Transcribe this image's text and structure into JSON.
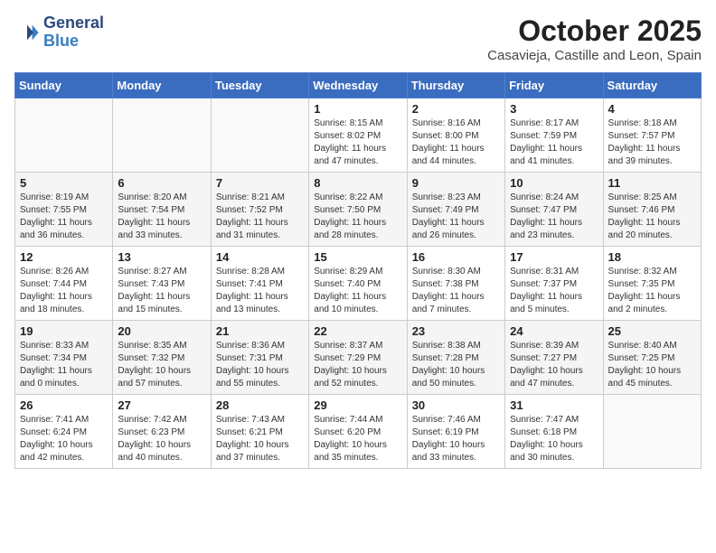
{
  "header": {
    "logo_line1": "General",
    "logo_line2": "Blue",
    "month_title": "October 2025",
    "location": "Casavieja, Castille and Leon, Spain"
  },
  "weekdays": [
    "Sunday",
    "Monday",
    "Tuesday",
    "Wednesday",
    "Thursday",
    "Friday",
    "Saturday"
  ],
  "weeks": [
    [
      {
        "day": "",
        "info": ""
      },
      {
        "day": "",
        "info": ""
      },
      {
        "day": "",
        "info": ""
      },
      {
        "day": "1",
        "info": "Sunrise: 8:15 AM\nSunset: 8:02 PM\nDaylight: 11 hours and 47 minutes."
      },
      {
        "day": "2",
        "info": "Sunrise: 8:16 AM\nSunset: 8:00 PM\nDaylight: 11 hours and 44 minutes."
      },
      {
        "day": "3",
        "info": "Sunrise: 8:17 AM\nSunset: 7:59 PM\nDaylight: 11 hours and 41 minutes."
      },
      {
        "day": "4",
        "info": "Sunrise: 8:18 AM\nSunset: 7:57 PM\nDaylight: 11 hours and 39 minutes."
      }
    ],
    [
      {
        "day": "5",
        "info": "Sunrise: 8:19 AM\nSunset: 7:55 PM\nDaylight: 11 hours and 36 minutes."
      },
      {
        "day": "6",
        "info": "Sunrise: 8:20 AM\nSunset: 7:54 PM\nDaylight: 11 hours and 33 minutes."
      },
      {
        "day": "7",
        "info": "Sunrise: 8:21 AM\nSunset: 7:52 PM\nDaylight: 11 hours and 31 minutes."
      },
      {
        "day": "8",
        "info": "Sunrise: 8:22 AM\nSunset: 7:50 PM\nDaylight: 11 hours and 28 minutes."
      },
      {
        "day": "9",
        "info": "Sunrise: 8:23 AM\nSunset: 7:49 PM\nDaylight: 11 hours and 26 minutes."
      },
      {
        "day": "10",
        "info": "Sunrise: 8:24 AM\nSunset: 7:47 PM\nDaylight: 11 hours and 23 minutes."
      },
      {
        "day": "11",
        "info": "Sunrise: 8:25 AM\nSunset: 7:46 PM\nDaylight: 11 hours and 20 minutes."
      }
    ],
    [
      {
        "day": "12",
        "info": "Sunrise: 8:26 AM\nSunset: 7:44 PM\nDaylight: 11 hours and 18 minutes."
      },
      {
        "day": "13",
        "info": "Sunrise: 8:27 AM\nSunset: 7:43 PM\nDaylight: 11 hours and 15 minutes."
      },
      {
        "day": "14",
        "info": "Sunrise: 8:28 AM\nSunset: 7:41 PM\nDaylight: 11 hours and 13 minutes."
      },
      {
        "day": "15",
        "info": "Sunrise: 8:29 AM\nSunset: 7:40 PM\nDaylight: 11 hours and 10 minutes."
      },
      {
        "day": "16",
        "info": "Sunrise: 8:30 AM\nSunset: 7:38 PM\nDaylight: 11 hours and 7 minutes."
      },
      {
        "day": "17",
        "info": "Sunrise: 8:31 AM\nSunset: 7:37 PM\nDaylight: 11 hours and 5 minutes."
      },
      {
        "day": "18",
        "info": "Sunrise: 8:32 AM\nSunset: 7:35 PM\nDaylight: 11 hours and 2 minutes."
      }
    ],
    [
      {
        "day": "19",
        "info": "Sunrise: 8:33 AM\nSunset: 7:34 PM\nDaylight: 11 hours and 0 minutes."
      },
      {
        "day": "20",
        "info": "Sunrise: 8:35 AM\nSunset: 7:32 PM\nDaylight: 10 hours and 57 minutes."
      },
      {
        "day": "21",
        "info": "Sunrise: 8:36 AM\nSunset: 7:31 PM\nDaylight: 10 hours and 55 minutes."
      },
      {
        "day": "22",
        "info": "Sunrise: 8:37 AM\nSunset: 7:29 PM\nDaylight: 10 hours and 52 minutes."
      },
      {
        "day": "23",
        "info": "Sunrise: 8:38 AM\nSunset: 7:28 PM\nDaylight: 10 hours and 50 minutes."
      },
      {
        "day": "24",
        "info": "Sunrise: 8:39 AM\nSunset: 7:27 PM\nDaylight: 10 hours and 47 minutes."
      },
      {
        "day": "25",
        "info": "Sunrise: 8:40 AM\nSunset: 7:25 PM\nDaylight: 10 hours and 45 minutes."
      }
    ],
    [
      {
        "day": "26",
        "info": "Sunrise: 7:41 AM\nSunset: 6:24 PM\nDaylight: 10 hours and 42 minutes."
      },
      {
        "day": "27",
        "info": "Sunrise: 7:42 AM\nSunset: 6:23 PM\nDaylight: 10 hours and 40 minutes."
      },
      {
        "day": "28",
        "info": "Sunrise: 7:43 AM\nSunset: 6:21 PM\nDaylight: 10 hours and 37 minutes."
      },
      {
        "day": "29",
        "info": "Sunrise: 7:44 AM\nSunset: 6:20 PM\nDaylight: 10 hours and 35 minutes."
      },
      {
        "day": "30",
        "info": "Sunrise: 7:46 AM\nSunset: 6:19 PM\nDaylight: 10 hours and 33 minutes."
      },
      {
        "day": "31",
        "info": "Sunrise: 7:47 AM\nSunset: 6:18 PM\nDaylight: 10 hours and 30 minutes."
      },
      {
        "day": "",
        "info": ""
      }
    ]
  ]
}
